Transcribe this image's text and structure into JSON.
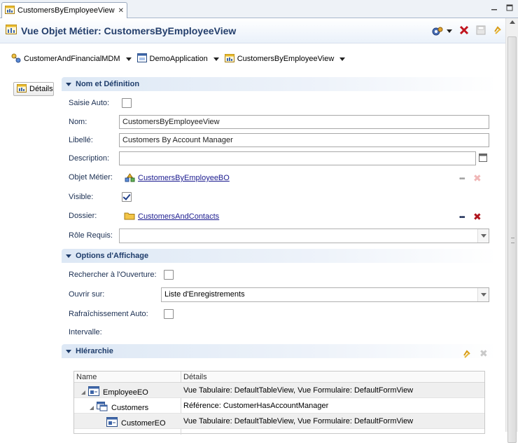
{
  "tab": {
    "title": "CustomersByEmployeeView"
  },
  "header": {
    "title": "Vue Objet Métier: CustomersByEmployeeView"
  },
  "breadcrumb": [
    {
      "label": "CustomerAndFinancialMDM"
    },
    {
      "label": "DemoApplication"
    },
    {
      "label": "CustomersByEmployeeView"
    }
  ],
  "sidebar": {
    "details_label": "Détails"
  },
  "sections": {
    "nom": {
      "title": "Nom et Définition"
    },
    "options": {
      "title": "Options d'Affichage"
    },
    "hierarchie": {
      "title": "HIérarchie"
    }
  },
  "form": {
    "saisie_auto": {
      "label": "Saisie Auto:",
      "checked": false
    },
    "nom": {
      "label": "Nom:",
      "value": "CustomersByEmployeeView"
    },
    "libelle": {
      "label": "Libellé:",
      "value": "Customers By Account Manager"
    },
    "description": {
      "label": "Description:",
      "value": ""
    },
    "objet_metier": {
      "label": "Objet Métier:",
      "value": "CustomersByEmployeeBO"
    },
    "visible": {
      "label": "Visible:",
      "checked": true
    },
    "dossier": {
      "label": "Dossier:",
      "value": "CustomersAndContacts"
    },
    "role_requis": {
      "label": "Rôle Requis:",
      "value": ""
    },
    "rechercher": {
      "label": "Rechercher à l'Ouverture:",
      "checked": false
    },
    "ouvrir_sur": {
      "label": "Ouvrir sur:",
      "value": "Liste d'Enregistrements"
    },
    "rafraichissement": {
      "label": "Rafraîchissement Auto:",
      "checked": false
    },
    "intervalle": {
      "label": "Intervalle:"
    }
  },
  "hierarchy": {
    "columns": [
      "Name",
      "Détails"
    ],
    "rows": [
      {
        "name": "EmployeeEO",
        "details": "Vue Tabulaire: DefaultTableView, Vue Formulaire: DefaultFormView"
      },
      {
        "name": "Customers",
        "details": "Référence: CustomerHasAccountManager"
      },
      {
        "name": "CustomerEO",
        "details": "Vue Tabulaire: DefaultTableView, Vue Formulaire: DefaultFormView"
      }
    ]
  },
  "colors": {
    "accent": "#233e6b",
    "delete_red": "#c0141e",
    "link": "#1b1b8f"
  }
}
